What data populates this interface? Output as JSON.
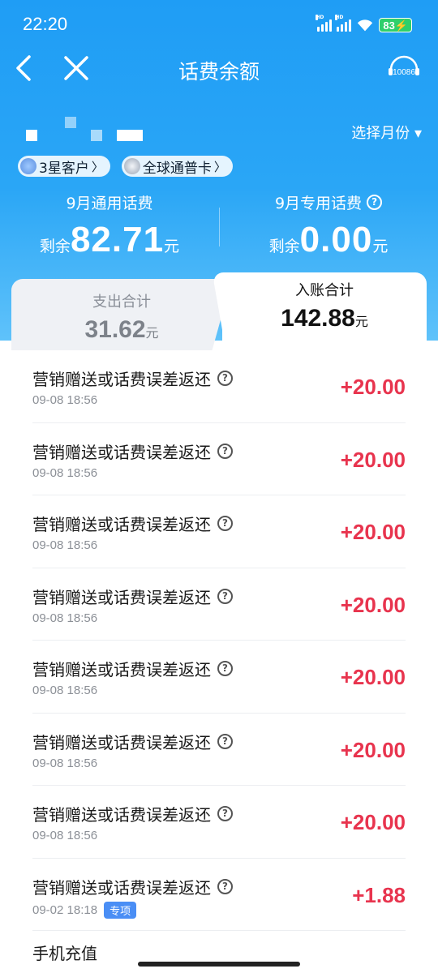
{
  "status_bar": {
    "time": "22:20",
    "battery": "83"
  },
  "nav": {
    "title": "话费余额",
    "service_label": "10086"
  },
  "account": {
    "month_select": "选择月份 ▾"
  },
  "badges": [
    {
      "label": "3星客户",
      "icon": "star-icon"
    },
    {
      "label": "全球通普卡",
      "icon": "card-icon"
    }
  ],
  "summary": {
    "general": {
      "label": "9月通用话费",
      "prefix": "剩余",
      "value": "82.71",
      "unit": "元"
    },
    "special": {
      "label": "9月专用话费",
      "prefix": "剩余",
      "value": "0.00",
      "unit": "元"
    }
  },
  "tabs": {
    "expense": {
      "title": "支出合计",
      "amount": "31.62",
      "unit": "元"
    },
    "income": {
      "title": "入账合计",
      "amount": "142.88",
      "unit": "元"
    }
  },
  "records": [
    {
      "title": "营销赠送或话费误差返还",
      "time": "09-08 18:56",
      "amount": "+20.00",
      "tag": ""
    },
    {
      "title": "营销赠送或话费误差返还",
      "time": "09-08 18:56",
      "amount": "+20.00",
      "tag": ""
    },
    {
      "title": "营销赠送或话费误差返还",
      "time": "09-08 18:56",
      "amount": "+20.00",
      "tag": ""
    },
    {
      "title": "营销赠送或话费误差返还",
      "time": "09-08 18:56",
      "amount": "+20.00",
      "tag": ""
    },
    {
      "title": "营销赠送或话费误差返还",
      "time": "09-08 18:56",
      "amount": "+20.00",
      "tag": ""
    },
    {
      "title": "营销赠送或话费误差返还",
      "time": "09-08 18:56",
      "amount": "+20.00",
      "tag": ""
    },
    {
      "title": "营销赠送或话费误差返还",
      "time": "09-08 18:56",
      "amount": "+20.00",
      "tag": ""
    },
    {
      "title": "营销赠送或话费误差返还",
      "time": "09-02 18:18",
      "amount": "+1.88",
      "tag": "专项"
    }
  ],
  "partial_record": {
    "title": "手机充值"
  },
  "colors": {
    "header_blue": "#1f9df5",
    "amount_red": "#e8344e",
    "tag_blue": "#4a8ef5"
  }
}
